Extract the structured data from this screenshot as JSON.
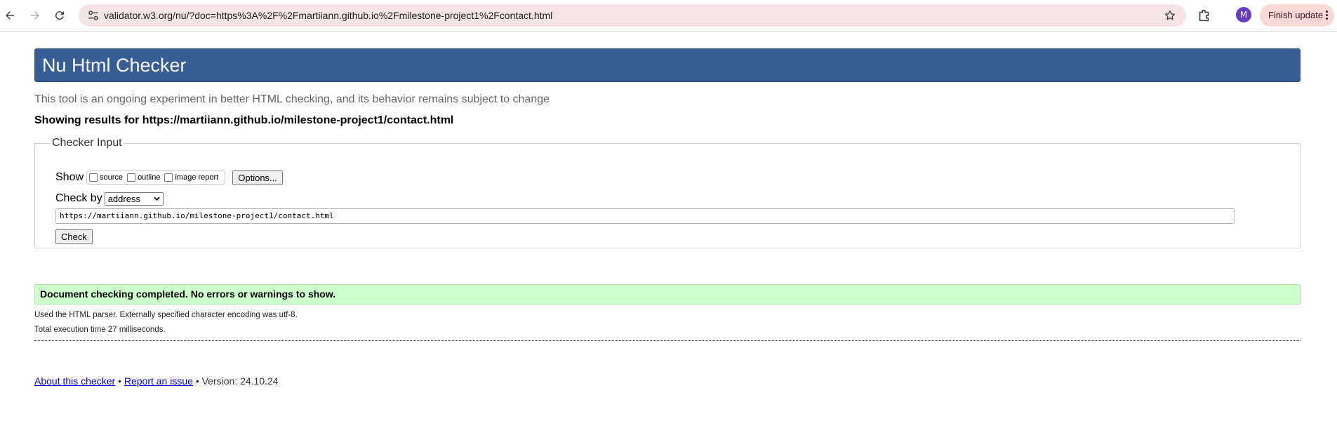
{
  "browser": {
    "url": "validator.w3.org/nu/?doc=https%3A%2F%2Fmartiiann.github.io%2Fmilestone-project1%2Fcontact.html",
    "avatar_letter": "M",
    "finish_update_label": "Finish update",
    "icons": [
      "back-arrow-icon",
      "forward-arrow-icon",
      "reload-icon",
      "site-settings-icon",
      "star-icon",
      "extensions-icon",
      "more-vert-icon"
    ]
  },
  "page": {
    "title": "Nu Html Checker",
    "subtitle": "This tool is an ongoing experiment in better HTML checking, and its behavior remains subject to change",
    "showing_results": "Showing results for https://martiiann.github.io/milestone-project1/contact.html",
    "checker_input": {
      "legend": "Checker Input",
      "show_label": "Show",
      "show_options": [
        "source",
        "outline",
        "image report"
      ],
      "options_button": "Options...",
      "check_by_label": "Check by",
      "check_by_value": "address",
      "url_value": "https://martiiann.github.io/milestone-project1/contact.html",
      "check_button": "Check"
    },
    "result": {
      "message": "Document checking completed. No errors or warnings to show.",
      "parser_note": "Used the HTML parser. Externally specified character encoding was utf-8.",
      "execution_time": "Total execution time 27 milliseconds."
    },
    "footer": {
      "about_link": "About this checker",
      "separator": "•",
      "report_link": "Report an issue",
      "version": "Version: 24.10.24"
    }
  },
  "colors": {
    "header_bg": "#365d95",
    "success_bg": "#ccffcc",
    "omnibox_bg": "#f4e4e6",
    "avatar_bg": "#6a3ac9",
    "finish_update_bg": "#f9d9d5"
  }
}
